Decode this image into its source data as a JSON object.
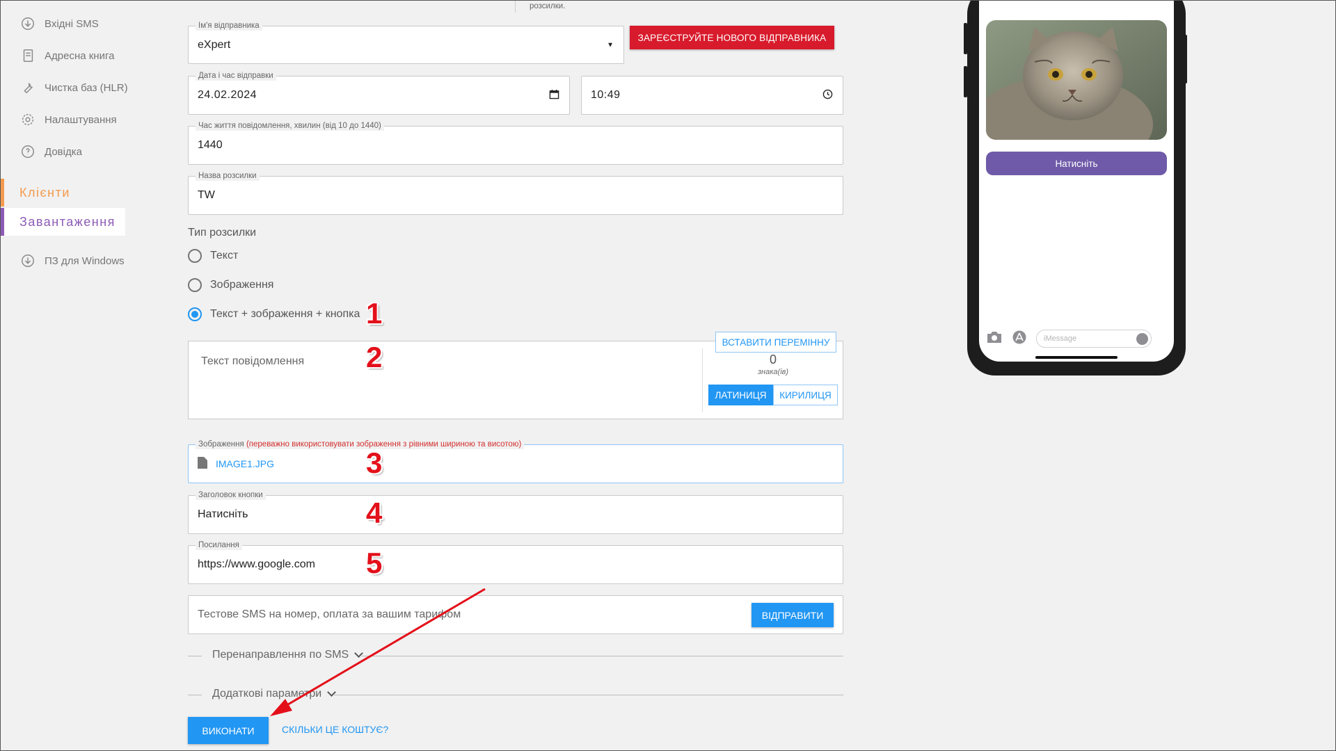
{
  "sidebar": {
    "items_top": [
      {
        "label": "Вхідні SMS",
        "icon": "download-circle-icon"
      },
      {
        "label": "Адресна книга",
        "icon": "book-icon"
      },
      {
        "label": "Чистка баз (HLR)",
        "icon": "wrench-icon"
      },
      {
        "label": "Налаштування",
        "icon": "gear-icon"
      },
      {
        "label": "Довідка",
        "icon": "help-circle-icon"
      }
    ],
    "section_clients": "Клієнти",
    "section_download": "Завантаження",
    "item_windows": {
      "label": "ПЗ для Windows",
      "icon": "download-circle-icon"
    }
  },
  "top_fragment": "розсилки.",
  "sender": {
    "label": "Ім'я відправника",
    "value": "eXpert",
    "register_button": "ЗАРЕЄСТРУЙТЕ НОВОГО ВІДПРАВНИКА"
  },
  "datetime": {
    "label": "Дата і час відправки",
    "date": "24.02.2024",
    "time": "10:49"
  },
  "lifetime": {
    "label": "Час життя повідомлення, хвилин (від 10 до 1440)",
    "value": "1440"
  },
  "campaign_name": {
    "label": "Назва розсилки",
    "value": "TW"
  },
  "type": {
    "title": "Тип розсилки",
    "options": [
      {
        "label": "Текст",
        "checked": false
      },
      {
        "label": "Зображення",
        "checked": false
      },
      {
        "label": "Текст + зображення + кнопка",
        "checked": true
      }
    ]
  },
  "message": {
    "placeholder": "Текст повідомлення",
    "insert_variable": "ВСТАВИТИ ПЕРЕМІННУ",
    "char_count": "0",
    "char_label": "знака(ів)",
    "latin": "ЛАТИНИЦЯ",
    "cyrillic": "КИРИЛИЦЯ"
  },
  "image": {
    "label": "Зображення",
    "hint": "(переважно використовувати зображення з рівними шириною та висотою)",
    "file": "IMAGE1.JPG"
  },
  "button_title": {
    "label": "Заголовок кнопки",
    "value": "Натисніть"
  },
  "link": {
    "label": "Посилання",
    "value": "https://www.google.com"
  },
  "test_sms": {
    "placeholder": "Тестове SMS на номер, оплата за вашим тарифом",
    "send": "ВІДПРАВИТИ"
  },
  "expanders": {
    "redirect": "Перенаправлення по SMS",
    "extra": "Додаткові параметри"
  },
  "actions": {
    "execute": "ВИКОНАТИ",
    "cost": "СКІЛЬКИ ЦЕ КОШТУЄ?"
  },
  "preview": {
    "button": "Натисніть",
    "input_placeholder": "iMessage"
  },
  "annotations": [
    "1",
    "2",
    "3",
    "4",
    "5"
  ],
  "colors": {
    "accent_blue": "#2196f3",
    "register_red": "#d81b2c",
    "clients_orange": "#f39a4e",
    "download_purple": "#8c5bb6",
    "phone_button": "#6e5aa8",
    "annotation_red": "#e3101a"
  }
}
